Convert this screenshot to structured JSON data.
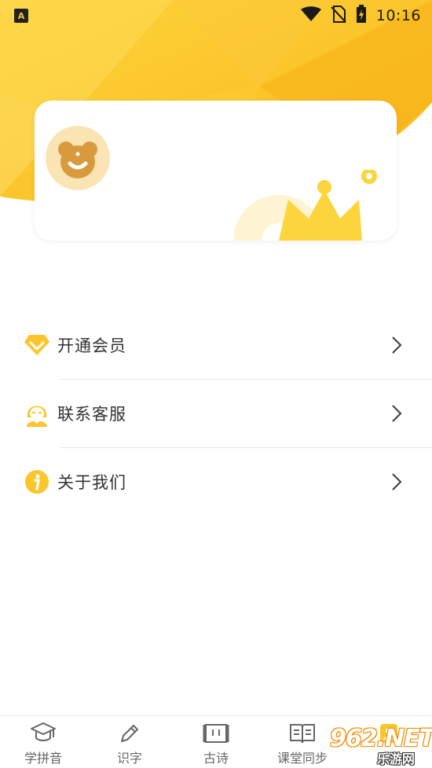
{
  "status_bar": {
    "time": "10:16",
    "left_icon": "A",
    "icons": [
      "wifi-icon",
      "no-sim-icon",
      "battery-charging-icon"
    ]
  },
  "profile_card": {
    "avatar_icon": "bear-face-icon",
    "decoration_icon": "crown-icon"
  },
  "menu": {
    "items": [
      {
        "label": "开通会员",
        "icon": "diamond-icon"
      },
      {
        "label": "联系客服",
        "icon": "customer-service-icon"
      },
      {
        "label": "关于我们",
        "icon": "info-icon"
      }
    ]
  },
  "tabs": [
    {
      "label": "学拼音",
      "icon": "graduation-cap-icon"
    },
    {
      "label": "识字",
      "icon": "pencil-icon"
    },
    {
      "label": "古诗",
      "icon": "scroll-icon"
    },
    {
      "label": "课堂同步",
      "icon": "book-icon"
    },
    {
      "label": "",
      "icon": "profile-icon"
    }
  ],
  "watermark": {
    "text": "962.NET",
    "subtext": "乐游网"
  },
  "colors": {
    "accent": "#FBC52C",
    "accent_light": "#FDE27A",
    "text": "#333333",
    "divider": "#E6E6E6"
  }
}
